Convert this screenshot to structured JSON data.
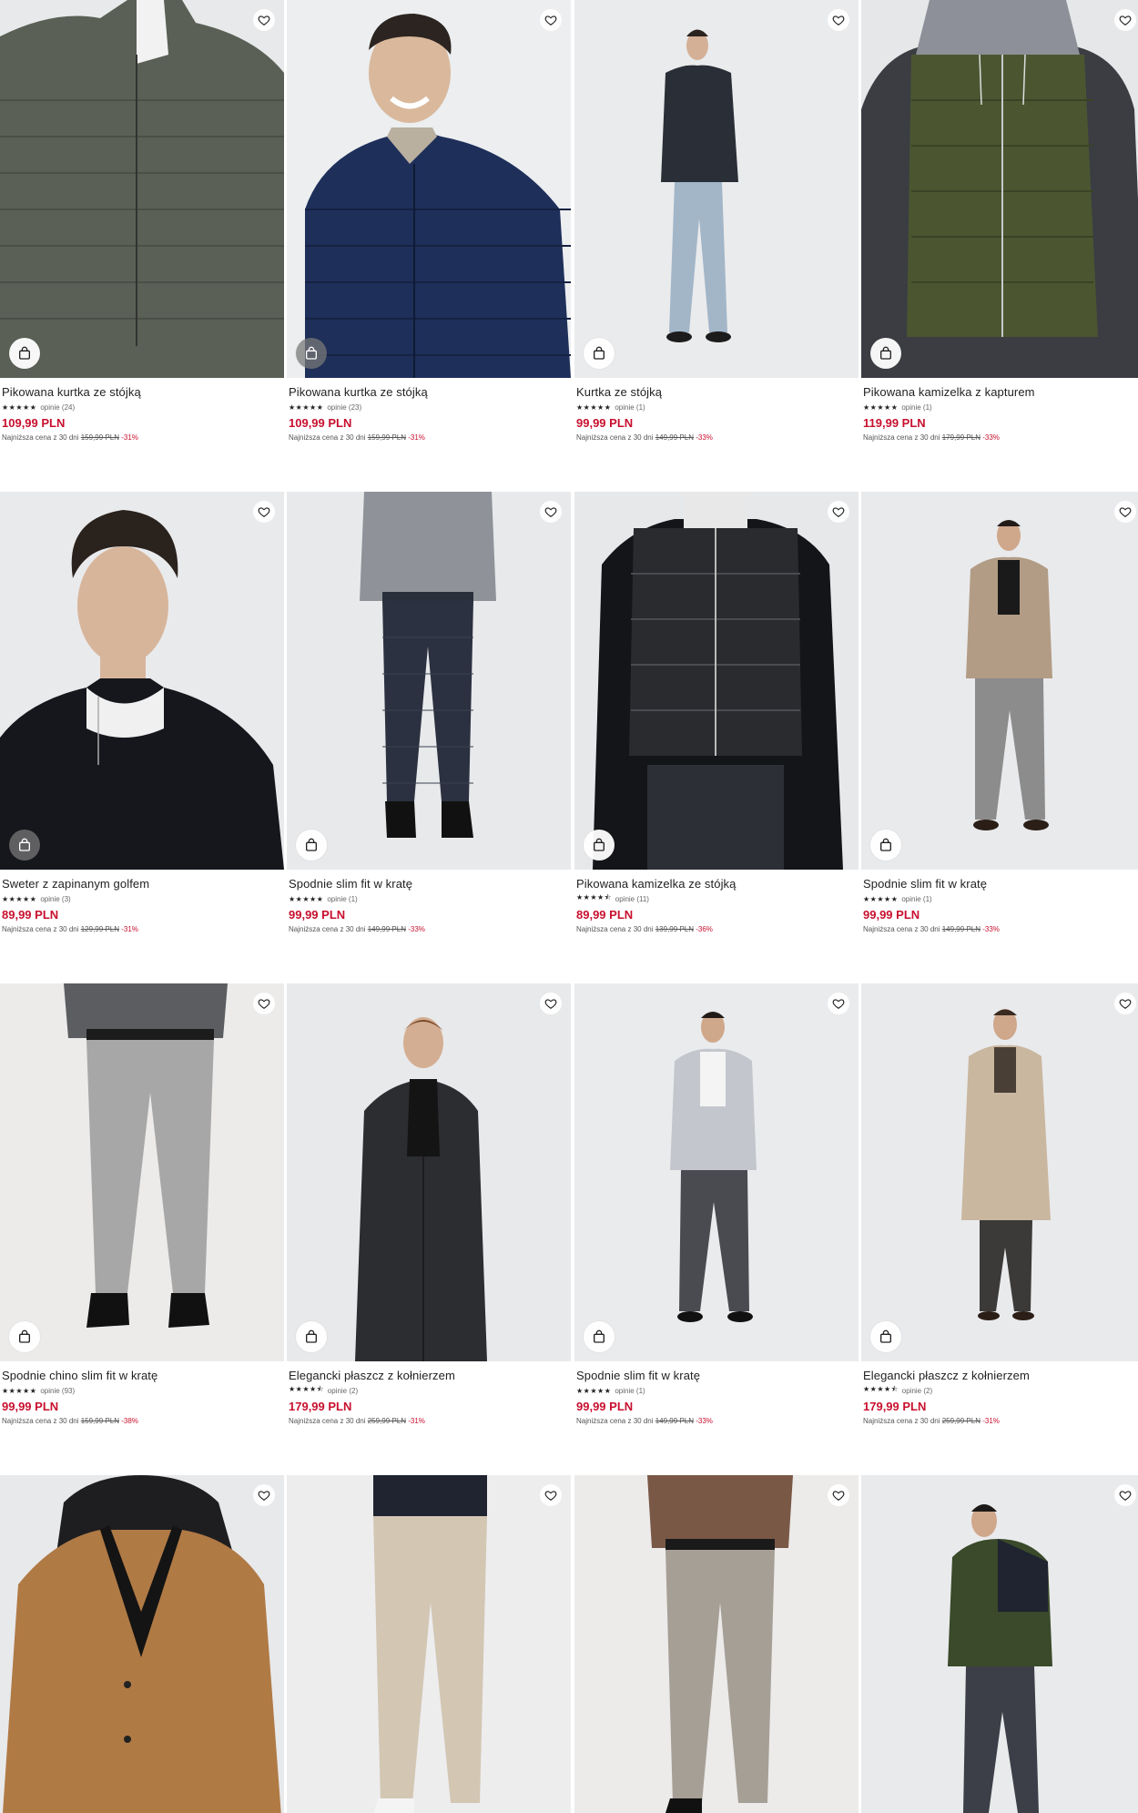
{
  "icons": {
    "favorite": "heart-outline-icon",
    "cart": "shopping-bag-icon"
  },
  "colors": {
    "price": "#c8102e",
    "discount": "#c8102e",
    "image_bg": "#e9eaec"
  },
  "products": [
    {
      "title": "Pikowana kurtka ze stójką",
      "stars": "★★★★★",
      "reviews": "opinie (24)",
      "price": "109,99 PLN",
      "lowest_prefix": "Najniższa cena z 30 dni",
      "old_price": "159,99 PLN",
      "discount": "-31%",
      "bag_dark": false
    },
    {
      "title": "Pikowana kurtka ze stójką",
      "stars": "★★★★★",
      "reviews": "opinie (23)",
      "price": "109,99 PLN",
      "lowest_prefix": "Najniższa cena z 30 dni",
      "old_price": "159,99 PLN",
      "discount": "-31%",
      "bag_dark": true
    },
    {
      "title": "Kurtka ze stójką",
      "stars": "★★★★★",
      "reviews": "opinie (1)",
      "price": "99,99 PLN",
      "lowest_prefix": "Najniższa cena z 30 dni",
      "old_price": "149,99 PLN",
      "discount": "-33%",
      "bag_dark": false
    },
    {
      "title": "Pikowana kamizelka z kapturem",
      "stars": "★★★★★",
      "reviews": "opinie (1)",
      "price": "119,99 PLN",
      "lowest_prefix": "Najniższa cena z 30 dni",
      "old_price": "179,99 PLN",
      "discount": "-33%",
      "bag_dark": false
    },
    {
      "title": "Sweter z zapinanym golfem",
      "stars": "★★★★★",
      "reviews": "opinie (3)",
      "price": "89,99 PLN",
      "lowest_prefix": "Najniższa cena z 30 dni",
      "old_price": "129,99 PLN",
      "discount": "-31%",
      "bag_dark": true
    },
    {
      "title": "Spodnie slim fit w kratę",
      "stars": "★★★★★",
      "reviews": "opinie (1)",
      "price": "99,99 PLN",
      "lowest_prefix": "Najniższa cena z 30 dni",
      "old_price": "149,99 PLN",
      "discount": "-33%",
      "bag_dark": false
    },
    {
      "title": "Pikowana kamizelka ze stójką",
      "stars": "★★★★⯪",
      "reviews": "opinie (11)",
      "price": "89,99 PLN",
      "lowest_prefix": "Najniższa cena z 30 dni",
      "old_price": "139,99 PLN",
      "discount": "-36%",
      "bag_dark": false
    },
    {
      "title": "Spodnie slim fit w kratę",
      "stars": "★★★★★",
      "reviews": "opinie (1)",
      "price": "99,99 PLN",
      "lowest_prefix": "Najniższa cena z 30 dni",
      "old_price": "149,99 PLN",
      "discount": "-33%",
      "bag_dark": false
    },
    {
      "title": "Spodnie chino slim fit w kratę",
      "stars": "★★★★★",
      "reviews": "opinie (93)",
      "price": "99,99 PLN",
      "lowest_prefix": "Najniższa cena z 30 dni",
      "old_price": "159,99 PLN",
      "discount": "-38%",
      "bag_dark": false
    },
    {
      "title": "Elegancki płaszcz z kołnierzem",
      "stars": "★★★★⯪",
      "reviews": "opinie (2)",
      "price": "179,99 PLN",
      "lowest_prefix": "Najniższa cena z 30 dni",
      "old_price": "259,99 PLN",
      "discount": "-31%",
      "bag_dark": false
    },
    {
      "title": "Spodnie slim fit w kratę",
      "stars": "★★★★★",
      "reviews": "opinie (1)",
      "price": "99,99 PLN",
      "lowest_prefix": "Najniższa cena z 30 dni",
      "old_price": "149,99 PLN",
      "discount": "-33%",
      "bag_dark": false
    },
    {
      "title": "Elegancki płaszcz z kołnierzem",
      "stars": "★★★★⯪",
      "reviews": "opinie (2)",
      "price": "179,99 PLN",
      "lowest_prefix": "Najniższa cena z 30 dni",
      "old_price": "259,99 PLN",
      "discount": "-31%",
      "bag_dark": false
    },
    {
      "title": "",
      "stars": "",
      "reviews": "",
      "price": "",
      "lowest_prefix": "",
      "old_price": "",
      "discount": "",
      "bag_dark": false
    },
    {
      "title": "",
      "stars": "",
      "reviews": "",
      "price": "",
      "lowest_prefix": "",
      "old_price": "",
      "discount": "",
      "bag_dark": false
    },
    {
      "title": "",
      "stars": "",
      "reviews": "",
      "price": "",
      "lowest_prefix": "",
      "old_price": "",
      "discount": "",
      "bag_dark": false
    },
    {
      "title": "",
      "stars": "",
      "reviews": "",
      "price": "",
      "lowest_prefix": "",
      "old_price": "",
      "discount": "",
      "bag_dark": false
    }
  ]
}
